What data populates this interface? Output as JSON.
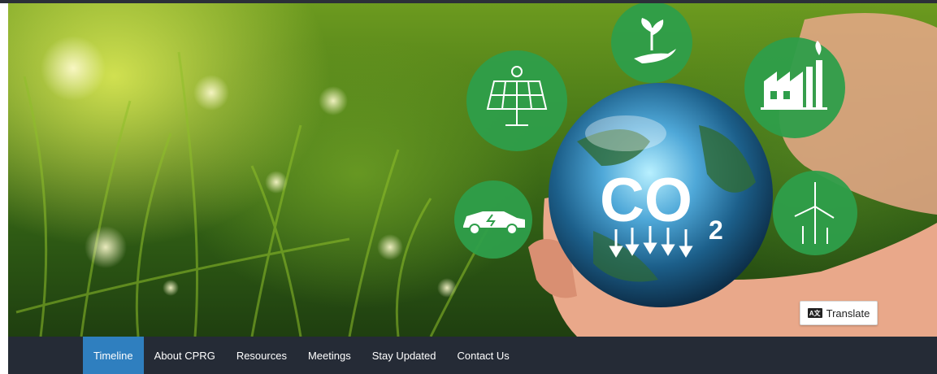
{
  "hero": {
    "co2_text": "CO",
    "co2_subscript": "2",
    "icons": [
      "plant-in-hand-icon",
      "solar-panel-icon",
      "factory-icon",
      "electric-car-icon",
      "wind-turbine-icon"
    ]
  },
  "translate": {
    "label": "Translate",
    "icon_text": "A文",
    "icon": "translate-icon"
  },
  "nav": {
    "items": [
      {
        "label": "Timeline",
        "active": true
      },
      {
        "label": "About CPRG",
        "active": false
      },
      {
        "label": "Resources",
        "active": false
      },
      {
        "label": "Meetings",
        "active": false
      },
      {
        "label": "Stay Updated",
        "active": false
      },
      {
        "label": "Contact Us",
        "active": false
      }
    ]
  },
  "colors": {
    "nav_bg": "#252b36",
    "nav_active": "#2f7fbf",
    "icon_circle": "#2e9e4a"
  }
}
